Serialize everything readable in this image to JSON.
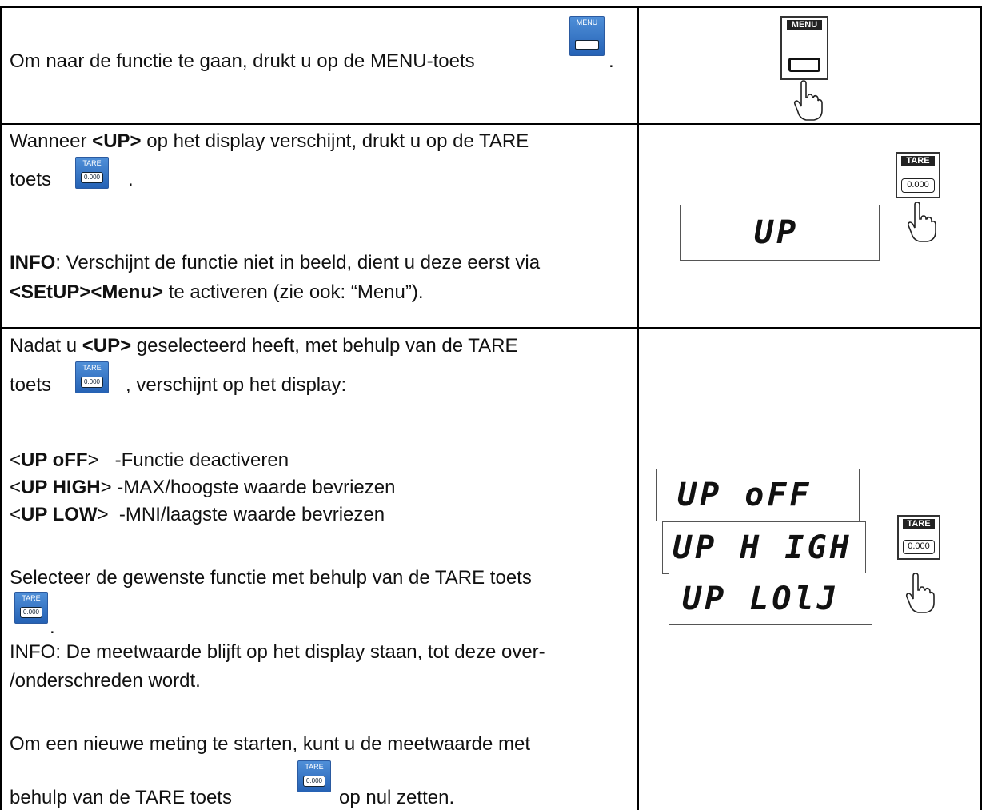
{
  "rows": [
    {
      "text": "Om naar de functie te gaan, drukt u op de MENU-toets",
      "after_icon": ".",
      "icon": "menu-key-icon",
      "icon_label": "MENU"
    },
    {
      "line1_a": "Wanneer ",
      "line1_b": "<UP>",
      "line1_c": " op het display verschijnt, drukt u op de TARE",
      "line2": "toets",
      "line2_after": ".",
      "info_label": "INFO",
      "info_text": ": Verschijnt de functie niet in beeld, dient u deze eerst via",
      "info2_b": "<SEtUP><Menu>",
      "info2_c": " te activeren (zie ook: “Menu”).",
      "lcd": "UP"
    },
    {
      "l1_a": "Nadat u ",
      "l1_b": "<UP>",
      "l1_c": " geselecteerd heeft, met behulp van de TARE",
      "l2_a": "toets",
      "l2_b": ", verschijnt op het display:",
      "opt1_a": "<",
      "opt1_b": "UP oFF",
      "opt1_c": ">   -Functie deactiveren",
      "opt2_a": "<",
      "opt2_b": "UP HIGH",
      "opt2_c": "> -MAX/hoogste waarde bevriezen",
      "opt3_a": "<",
      "opt3_b": "UP LOW",
      "opt3_c": ">  -MNI/laagste waarde bevriezen",
      "select": "Selecteer de gewenste functie met behulp van de TARE toets",
      "select_after": ".",
      "info1": "INFO: De meetwaarde blijft op het display staan, tot deze over-",
      "info2": "/onderschreden wordt.",
      "new1": "Om een nieuwe meting te starten, kunt u de meetwaarde met",
      "new2_a": "behulp van de TARE toets",
      "new2_b": "op nul zetten.",
      "lcd1": "UP oFF",
      "lcd2": "UP H IGH",
      "lcd3": "UP LOlJ"
    }
  ],
  "keys": {
    "menu": "MENU",
    "tare": "TARE",
    "tare_value": "0.000"
  },
  "colors": {
    "key_blue": "#2562b5",
    "border": "#000000"
  }
}
